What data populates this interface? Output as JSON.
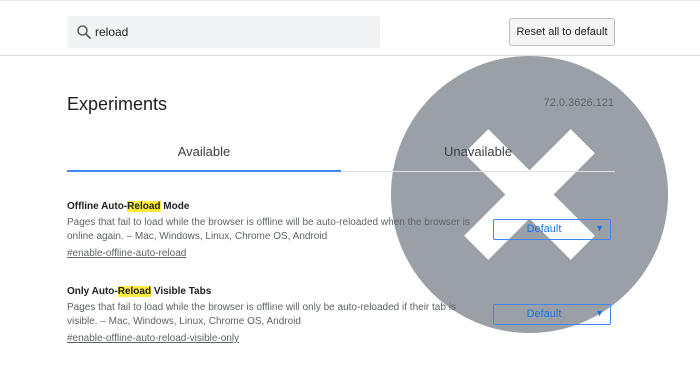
{
  "search": {
    "query": "reload"
  },
  "header": {
    "reset_label": "Reset all to default"
  },
  "page": {
    "title": "Experiments",
    "version": "72.0.3626.121"
  },
  "tabs": [
    {
      "label": "Available",
      "active": true
    },
    {
      "label": "Unavailable",
      "active": false
    }
  ],
  "experiments": [
    {
      "title_pre": "Offline Auto-",
      "title_hl": "Reload",
      "title_post": " Mode",
      "description": "Pages that fail to load while the browser is offline will be auto-reloaded when the browser is online again. – Mac, Windows, Linux, Chrome OS, Android",
      "link": "#enable-offline-auto-reload",
      "select_value": "Default"
    },
    {
      "title_pre": "Only Auto-",
      "title_hl": "Reload",
      "title_post": " Visible Tabs",
      "description": "Pages that fail to load while the browser is offline will only be auto-reloaded if their tab is visible. – Mac, Windows, Linux, Chrome OS, Android",
      "link": "#enable-offline-auto-reload-visible-only",
      "select_value": "Default"
    }
  ],
  "colors": {
    "accent": "#4285f4",
    "highlight": "#ffeb3b",
    "search_bg": "#f1f3f4"
  }
}
